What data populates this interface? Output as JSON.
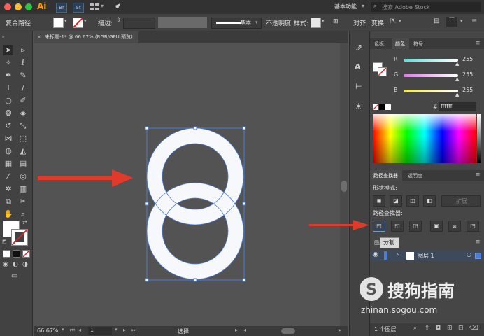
{
  "appbar": {
    "app_icon": "Ai",
    "br_icon": "Br",
    "st_icon": "St",
    "workspace_label": "基本功能",
    "search_placeholder": "搜索 Adobe Stock"
  },
  "control_bar": {
    "object_type": "复合路径",
    "stroke_label": "描边:",
    "brush_preset": "基本",
    "opacity_label": "不透明度",
    "style_label": "样式:",
    "align_label": "对齐",
    "transform_label": "变换"
  },
  "document_tab": {
    "title": "未标题-1* @ 66.67% (RGB/GPU 预览)",
    "close": "×"
  },
  "status_bar": {
    "zoom": "66.67%",
    "artboard": "1",
    "tool_name": "选择"
  },
  "color_panel": {
    "tabs": [
      "色板",
      "颜色",
      "符号"
    ],
    "channels": [
      {
        "label": "R",
        "value": "255",
        "color": "#58e0d8"
      },
      {
        "label": "G",
        "value": "255",
        "color": "#e078e8"
      },
      {
        "label": "B",
        "value": "255",
        "color": "#f0e850"
      }
    ],
    "hex_symbol": "#",
    "hex_value": "ffffff"
  },
  "pathfinder_panel": {
    "tabs": [
      "路径查找器",
      "透明度"
    ],
    "shape_modes_label": "形状模式:",
    "expand_label": "扩展",
    "pathfinders_label": "路径查找器:",
    "tooltip": "分割"
  },
  "layers_panel": {
    "tab": "图层",
    "layer_name": "图层 1",
    "count": "1 个图层"
  },
  "watermark": {
    "brand": "搜狗指南",
    "url": "zhinan.sogou.com"
  },
  "colors": {
    "accent_arrow": "#e23a2a",
    "selection": "#4a7cd8",
    "ring_fill": "#f6f8fc"
  }
}
